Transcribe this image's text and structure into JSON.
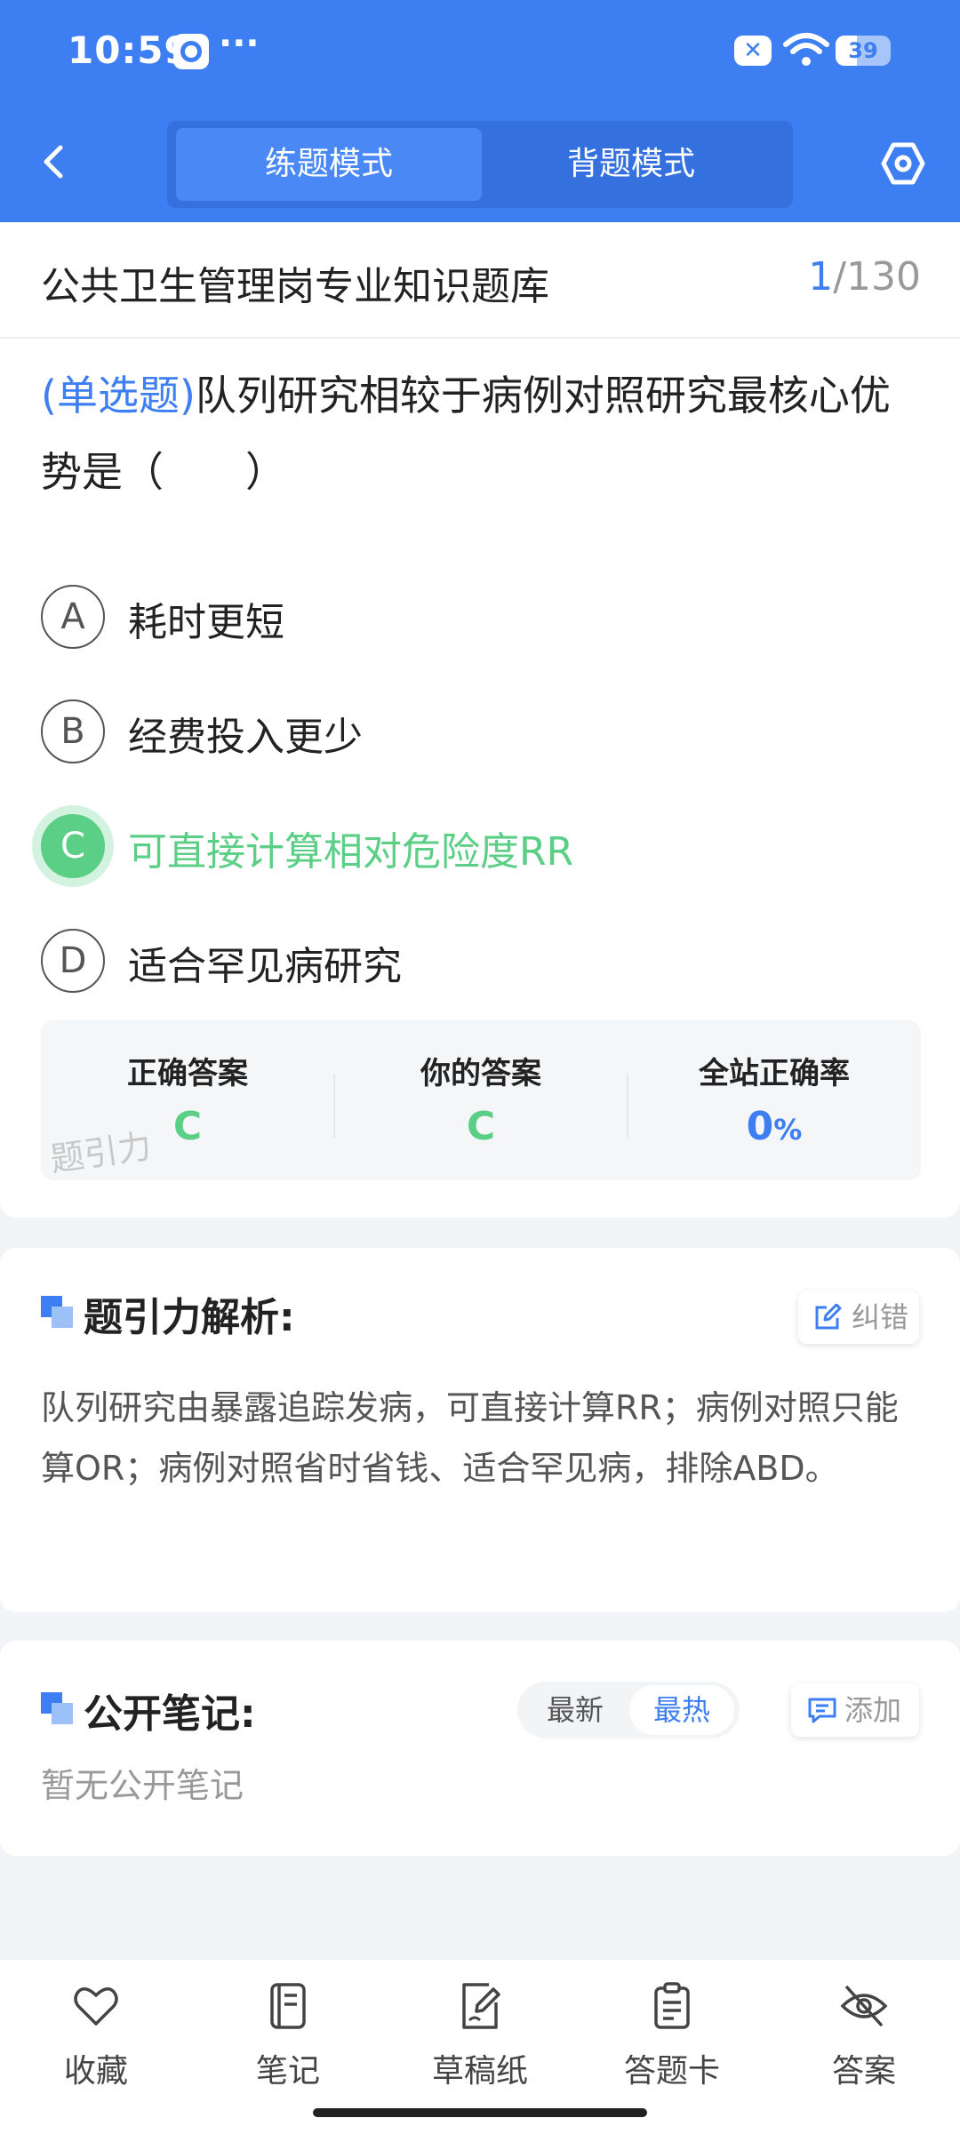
{
  "status_bar": {
    "time": "10:59",
    "dots": "···",
    "battery": "39",
    "battery_level": 0.39
  },
  "header": {
    "tabs": [
      {
        "label": "练题模式",
        "active": true
      },
      {
        "label": "背题模式",
        "active": false
      }
    ]
  },
  "question_bank": {
    "title": "公共卫生管理岗专业知识题库",
    "current": "1",
    "total": "/130"
  },
  "question": {
    "type": "(单选题)",
    "text": "队列研究相较于病例对照研究最核心优势是（　　）",
    "options": [
      {
        "letter": "A",
        "text": "耗时更短"
      },
      {
        "letter": "B",
        "text": "经费投入更少"
      },
      {
        "letter": "C",
        "text": "可直接计算相对危险度RR"
      },
      {
        "letter": "D",
        "text": "适合罕见病研究"
      }
    ]
  },
  "result": {
    "correct_label": "正确答案",
    "correct_value": "C",
    "yours_label": "你的答案",
    "yours_value": "C",
    "rate_label": "全站正确率",
    "rate_value": "0",
    "rate_unit": "%",
    "watermark": "题引力"
  },
  "analysis": {
    "title": "题引力解析:",
    "report_label": "纠错",
    "text": "队列研究由暴露追踪发病，可直接计算RR；病例对照只能算OR；病例对照省时省钱、适合罕见病，排除ABD。"
  },
  "notes": {
    "title": "公开笔记:",
    "sort_latest": "最新",
    "sort_hot": "最热",
    "add_label": "添加",
    "empty": "暂无公开笔记"
  },
  "bottom_nav": [
    {
      "label": "收藏",
      "icon": "heart-icon"
    },
    {
      "label": "笔记",
      "icon": "notebook-icon"
    },
    {
      "label": "草稿纸",
      "icon": "draft-icon"
    },
    {
      "label": "答题卡",
      "icon": "clipboard-icon"
    },
    {
      "label": "答案",
      "icon": "eye-off-icon"
    }
  ],
  "colors": {
    "primary": "#3d7ef2",
    "correct": "#5bcf86",
    "background": "#f2f4f7"
  }
}
